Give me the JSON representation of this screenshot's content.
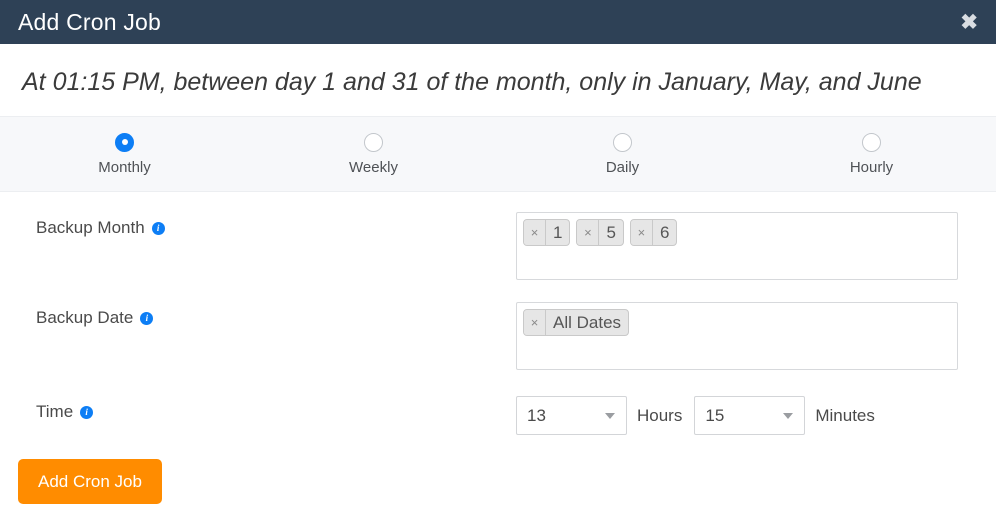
{
  "header": {
    "title": "Add Cron Job",
    "close_label": "✖"
  },
  "description": "At 01:15 PM, between day 1 and 31 of the month, only in January, May, and June",
  "frequency": {
    "selected": "Monthly",
    "options": [
      {
        "label": "Monthly",
        "checked": true
      },
      {
        "label": "Weekly",
        "checked": false
      },
      {
        "label": "Daily",
        "checked": false
      },
      {
        "label": "Hourly",
        "checked": false
      }
    ]
  },
  "fields": {
    "backup_month": {
      "label": "Backup Month",
      "info": "i",
      "chips": [
        {
          "value": "1",
          "remove": "×"
        },
        {
          "value": "5",
          "remove": "×"
        },
        {
          "value": "6",
          "remove": "×"
        }
      ]
    },
    "backup_date": {
      "label": "Backup Date",
      "info": "i",
      "chips": [
        {
          "value": "All Dates",
          "remove": "×"
        }
      ]
    },
    "time": {
      "label": "Time",
      "info": "i",
      "hours_value": "13",
      "hours_unit": "Hours",
      "minutes_value": "15",
      "minutes_unit": "Minutes"
    }
  },
  "submit": {
    "label": "Add Cron Job"
  },
  "colors": {
    "header_bg": "#2e4156",
    "accent_blue": "#0d7ef5",
    "submit_orange": "#ff8c00",
    "strip_bg": "#f7f8fa"
  }
}
